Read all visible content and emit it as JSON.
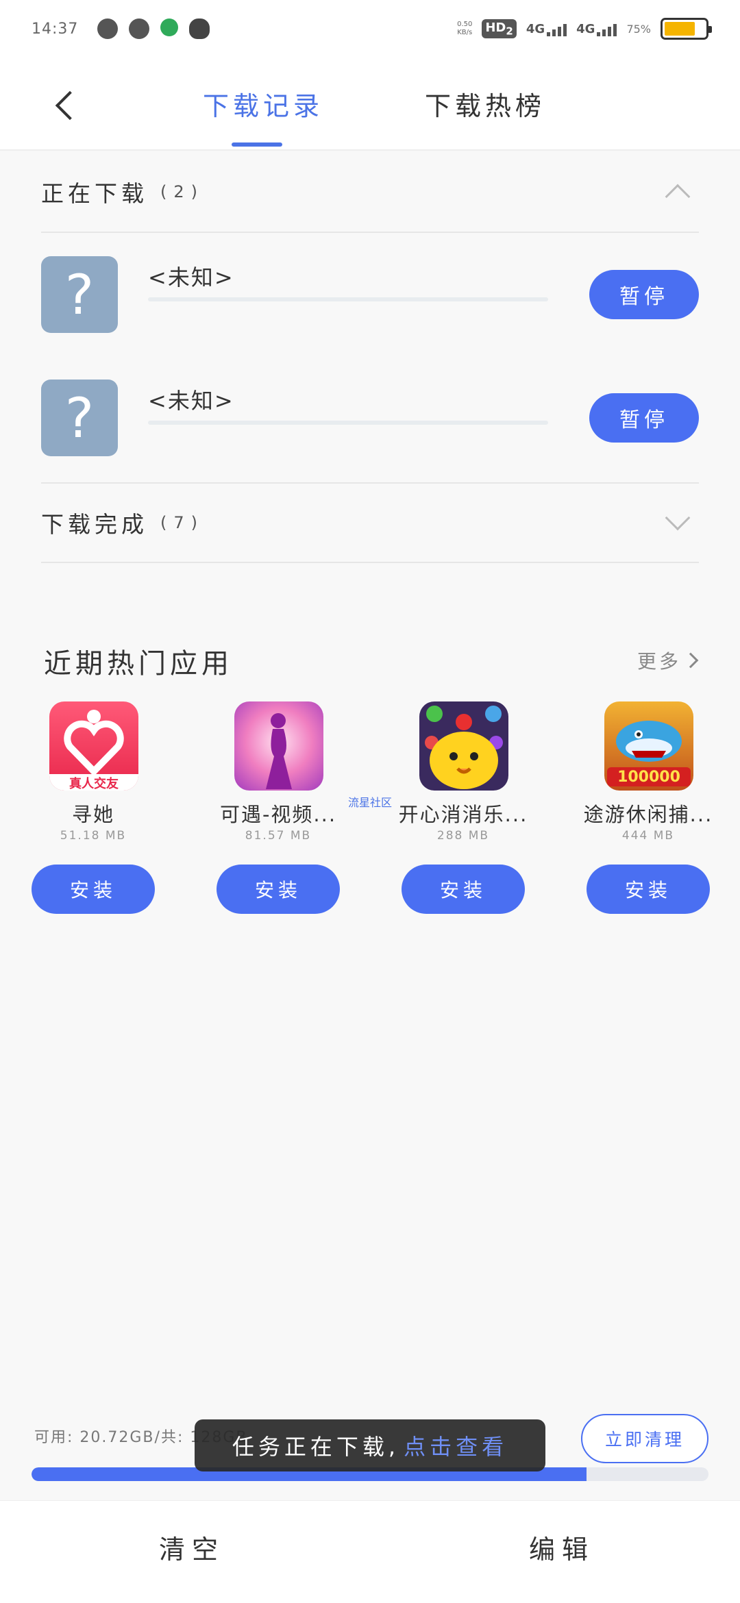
{
  "status_bar": {
    "time": "14:37",
    "net_speed_value": "0.50",
    "net_speed_unit": "KB/s",
    "hd": "HD",
    "hd_sub": "2",
    "signal1": "4G",
    "signal2": "4G",
    "battery_pct": "75%"
  },
  "header": {
    "tabs": [
      {
        "label": "下载记录",
        "active": true
      },
      {
        "label": "下载热榜",
        "active": false
      }
    ]
  },
  "downloading": {
    "title": "正在下载",
    "count": "(2)",
    "items": [
      {
        "name": "<未知>",
        "icon_glyph": "?",
        "action_label": "暂停"
      },
      {
        "name": "<未知>",
        "icon_glyph": "?",
        "action_label": "暂停"
      }
    ]
  },
  "completed": {
    "title": "下载完成",
    "count": "(7)"
  },
  "hot_apps": {
    "title": "近期热门应用",
    "more_label": "更多",
    "watermark": "流星社区",
    "apps": [
      {
        "name": "寻她",
        "size": "51.18 MB",
        "install_label": "安装",
        "icon_badge": "真人交友"
      },
      {
        "name": "可遇-视频...",
        "size": "81.57 MB",
        "install_label": "安装"
      },
      {
        "name": "开心消消乐...",
        "size": "288 MB",
        "install_label": "安装"
      },
      {
        "name": "途游休闲捕...",
        "size": "444 MB",
        "install_label": "安装",
        "icon_badge": "100000"
      }
    ]
  },
  "storage": {
    "text": "可用: 20.72GB/共: 128GB",
    "used_fraction": 0.82,
    "clean_label": "立即清理"
  },
  "toast": {
    "message": "任务正在下载,",
    "link": "点击查看"
  },
  "bottom": {
    "clear_label": "清空",
    "edit_label": "编辑"
  },
  "colors": {
    "accent": "#4a6ff2",
    "tab_active": "#4b73e6",
    "battery": "#f5b400"
  }
}
